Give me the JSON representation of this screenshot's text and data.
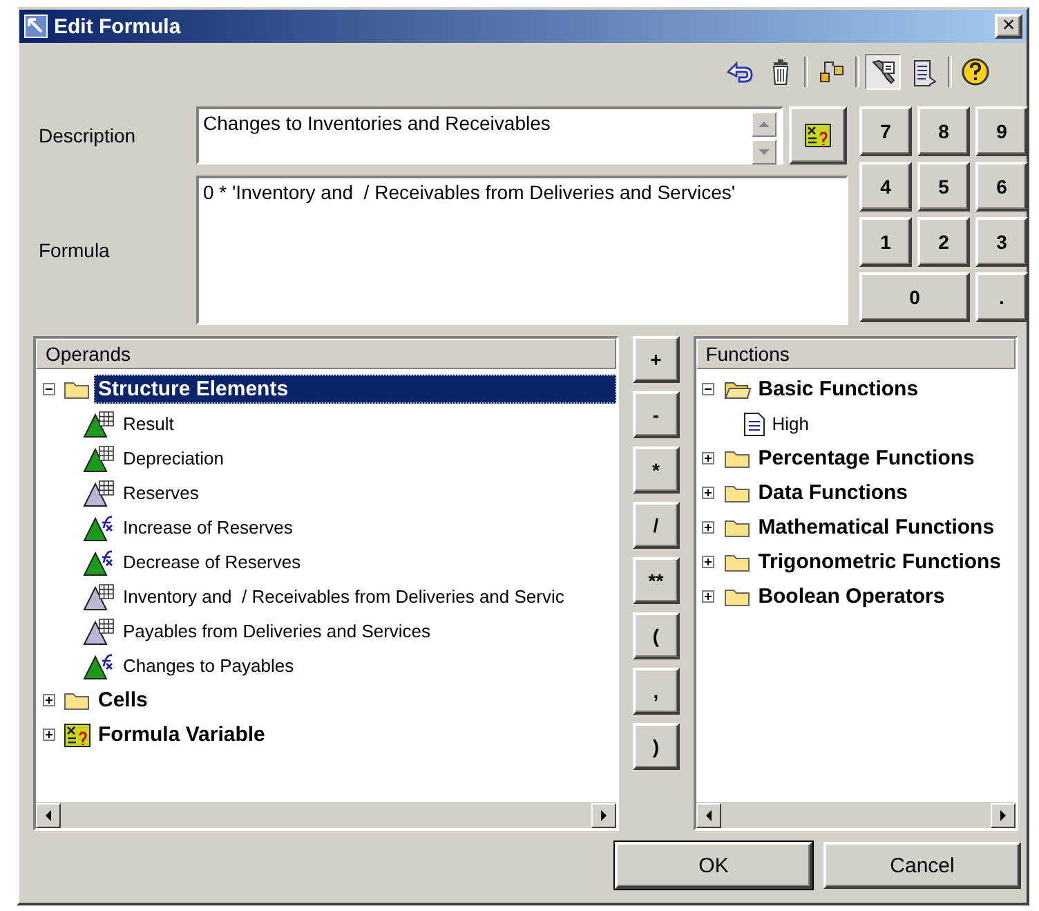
{
  "window": {
    "title": "Edit Formula",
    "close": "×"
  },
  "toolbar": [
    {
      "kind": "undo",
      "pressed": false
    },
    {
      "kind": "delete",
      "pressed": false
    },
    {
      "kind": "sep"
    },
    {
      "kind": "hierarchy",
      "pressed": false
    },
    {
      "kind": "sep"
    },
    {
      "kind": "tools",
      "pressed": true
    },
    {
      "kind": "document",
      "pressed": false
    },
    {
      "kind": "sep"
    },
    {
      "kind": "help",
      "pressed": false
    }
  ],
  "description": {
    "label": "Description",
    "value": "Changes to Inventories and Receivables"
  },
  "formula": {
    "label": "Formula",
    "value": "0 * 'Inventory and  / Receivables from Deliveries and Services'"
  },
  "keypad": [
    "7",
    "8",
    "9",
    "4",
    "5",
    "6",
    "1",
    "2",
    "3",
    "0",
    "."
  ],
  "operands": {
    "title": "Operands",
    "tree": [
      {
        "label": "Structure Elements",
        "kind": "folder",
        "expanded": true,
        "selected": true,
        "children": [
          {
            "label": "Result",
            "kind": "grid",
            "color": "#1c9a1c",
            "selected": false
          },
          {
            "label": "Depreciation",
            "kind": "grid",
            "color": "#1c9a1c",
            "selected": false
          },
          {
            "label": "Reserves",
            "kind": "grid",
            "color": "#b4b8d4",
            "selected": false
          },
          {
            "label": "Increase of Reserves",
            "kind": "fx",
            "color": "#1c9a1c",
            "selected": false
          },
          {
            "label": "Decrease of Reserves",
            "kind": "fx",
            "color": "#1c9a1c",
            "selected": false
          },
          {
            "label": "Inventory and  / Receivables from Deliveries and Servic",
            "kind": "grid",
            "color": "#b4b8d4",
            "selected": false
          },
          {
            "label": "Payables from Deliveries and Services",
            "kind": "grid",
            "color": "#b4b8d4",
            "selected": false
          },
          {
            "label": "Changes to Payables",
            "kind": "fx",
            "color": "#1c9a1c",
            "selected": false
          }
        ]
      },
      {
        "label": "Cells",
        "kind": "folder",
        "expanded": false,
        "selected": false
      },
      {
        "label": "Formula Variable",
        "kind": "variable",
        "expanded": false,
        "selected": false
      }
    ]
  },
  "operators": [
    "+",
    "-",
    "*",
    "/",
    "**",
    "(",
    ",",
    ")"
  ],
  "functions": {
    "title": "Functions",
    "tree": [
      {
        "label": "Basic Functions",
        "kind": "folder",
        "expanded": true,
        "selected": false,
        "children": [
          {
            "label": "High",
            "kind": "doc",
            "selected": false
          }
        ]
      },
      {
        "label": "Percentage Functions",
        "kind": "folder",
        "expanded": false,
        "selected": false
      },
      {
        "label": "Data Functions",
        "kind": "folder",
        "expanded": false,
        "selected": false
      },
      {
        "label": "Mathematical Functions",
        "kind": "folder",
        "expanded": false,
        "selected": false
      },
      {
        "label": "Trigonometric Functions",
        "kind": "folder",
        "expanded": false,
        "selected": false
      },
      {
        "label": "Boolean Operators",
        "kind": "folder",
        "expanded": false,
        "selected": false
      }
    ]
  },
  "buttons": [
    "OK",
    "Cancel"
  ]
}
